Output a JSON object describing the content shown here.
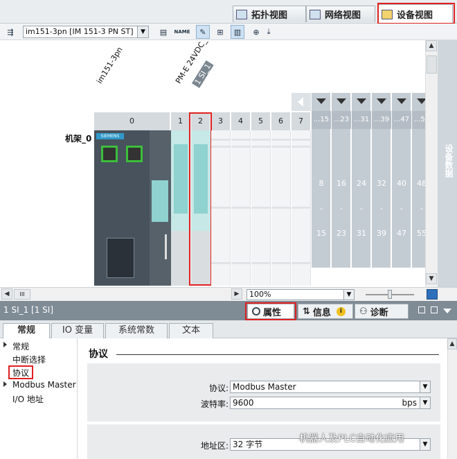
{
  "view_tabs": [
    {
      "label": "拓扑视图"
    },
    {
      "label": "网络视图"
    },
    {
      "label": "设备视图"
    }
  ],
  "toolbar": {
    "device_select": "im151-3pn [IM 151-3 PN ST]",
    "name_btn": "NAME"
  },
  "canvas": {
    "device_labels": [
      "im151-3pn",
      "PM-E 24VDC_1",
      "1 SI_1"
    ],
    "rack_label": "机架_0",
    "slots": [
      "0",
      "1",
      "2",
      "3",
      "4",
      "5",
      "6",
      "7"
    ],
    "expansion_ranges": [
      "...15",
      "...23",
      "...31",
      "...39",
      "...47",
      "...55"
    ],
    "expansion_start": [
      "8",
      "16",
      "24",
      "32",
      "40",
      "48"
    ],
    "expansion_dash": "-",
    "expansion_end": [
      "15",
      "23",
      "31",
      "39",
      "47",
      "55"
    ],
    "siemens": "SIEMENS"
  },
  "side_panel": "设备数据",
  "statusbar": {
    "scroll_mark": "III",
    "zoom": "100%"
  },
  "inspector": {
    "title": "1 SI_1 [1 SI]",
    "tabs": [
      {
        "label": "属性"
      },
      {
        "label": "信息"
      },
      {
        "label": "诊断"
      }
    ],
    "info_badge": "i",
    "subtabs": [
      {
        "label": "常规"
      },
      {
        "label": "IO 变量"
      },
      {
        "label": "系统常数"
      },
      {
        "label": "文本"
      }
    ],
    "nav": [
      "常规",
      "中断选择",
      "协议",
      "Modbus Master",
      "I/O 地址"
    ],
    "section_title": "协议",
    "fields": {
      "protocol_label": "协议:",
      "protocol_value": "Modbus Master",
      "baud_label": "波特率:",
      "baud_value": "9600",
      "baud_unit": "bps",
      "addr_label": "地址区:",
      "addr_value": "32 字节"
    }
  },
  "watermark": "机器人及PLC自动化应用",
  "colors": {
    "highlight": "#e02020",
    "expansion": "#c4ccd3",
    "inspector_bar": "#7f8b95"
  }
}
